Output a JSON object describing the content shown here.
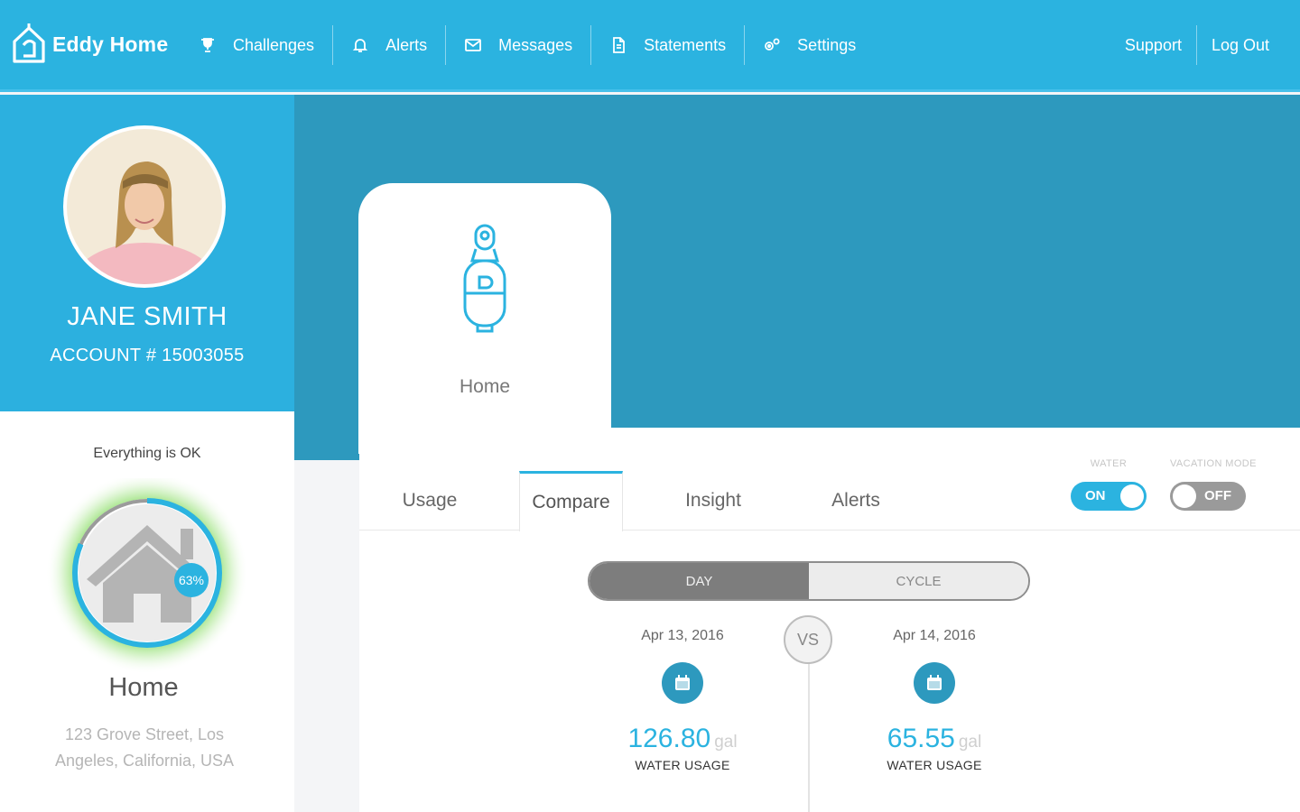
{
  "header": {
    "brand": "Eddy Home",
    "nav": [
      {
        "label": "Challenges",
        "icon": "trophy-icon"
      },
      {
        "label": "Alerts",
        "icon": "bell-icon"
      },
      {
        "label": "Messages",
        "icon": "envelope-icon"
      },
      {
        "label": "Statements",
        "icon": "document-icon"
      },
      {
        "label": "Settings",
        "icon": "gears-icon"
      }
    ],
    "support": "Support",
    "logout": "Log Out"
  },
  "profile": {
    "name": "JANE SMITH",
    "account": "ACCOUNT # 15003055"
  },
  "home": {
    "status": "Everything is OK",
    "percent_label": "63%",
    "percent": 63,
    "name": "Home",
    "address": "123 Grove Street, Los Angeles, California, USA"
  },
  "device": {
    "label": "Home"
  },
  "tabs": [
    "Usage",
    "Compare",
    "Insight",
    "Alerts"
  ],
  "active_tab": "Compare",
  "toggles": {
    "water": {
      "label": "WATER",
      "state": "ON"
    },
    "vacation": {
      "label": "VACATION MODE",
      "state": "OFF"
    }
  },
  "compare": {
    "segments": [
      "DAY",
      "CYCLE"
    ],
    "active_segment": "DAY",
    "vs": "VS",
    "left": {
      "date": "Apr 13, 2016",
      "value": "126.80",
      "unit": "gal",
      "label": "WATER USAGE"
    },
    "right": {
      "date": "Apr 14, 2016",
      "value": "65.55",
      "unit": "gal",
      "label": "WATER USAGE"
    }
  },
  "colors": {
    "primary": "#2bb3e0",
    "banner": "#2d99be",
    "gauge_glow": "#7ed957"
  }
}
